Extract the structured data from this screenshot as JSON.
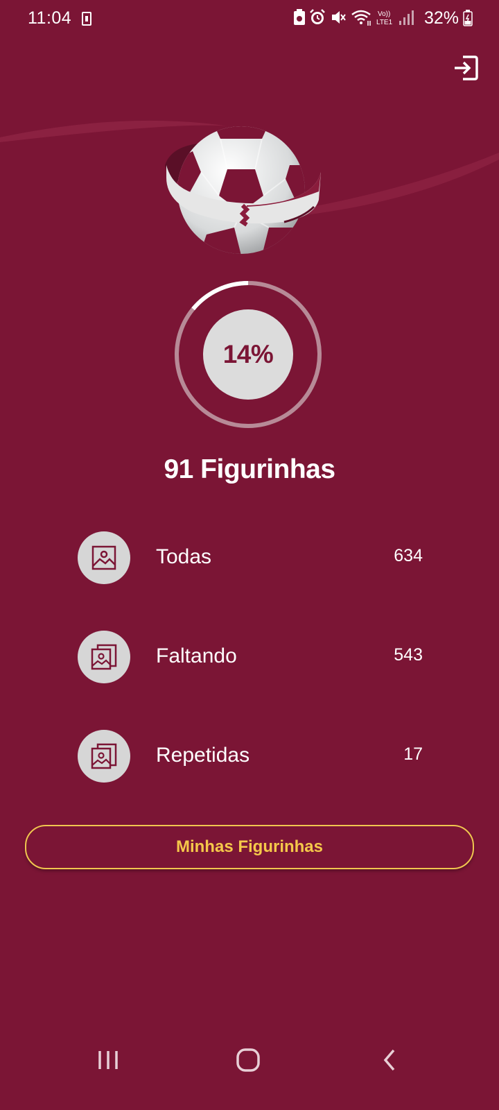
{
  "status_bar": {
    "time": "11:04",
    "battery_percent": "32%",
    "icons": [
      "sim-card-icon",
      "battery-saver-icon",
      "alarm-icon",
      "mute-icon",
      "wifi-icon",
      "volte-icon",
      "signal-icon",
      "battery-icon"
    ]
  },
  "header": {
    "exit_icon": "logout-icon"
  },
  "progress": {
    "percent_label": "14%",
    "fraction": 0.14
  },
  "summary": {
    "title": "91 Figurinhas"
  },
  "stats": [
    {
      "label": "Todas",
      "value": "634",
      "icon": "image-icon"
    },
    {
      "label": "Faltando",
      "value": "543",
      "icon": "image-stack-icon"
    },
    {
      "label": "Repetidas",
      "value": "17",
      "icon": "image-stack-icon"
    }
  ],
  "actions": {
    "my_stickers_label": "Minhas Figurinhas"
  },
  "nav": {
    "items": [
      "recent-apps-icon",
      "home-icon",
      "back-icon"
    ]
  },
  "colors": {
    "background": "#7b1535",
    "accent": "#f5c84a",
    "circle": "#dcdcdc"
  }
}
